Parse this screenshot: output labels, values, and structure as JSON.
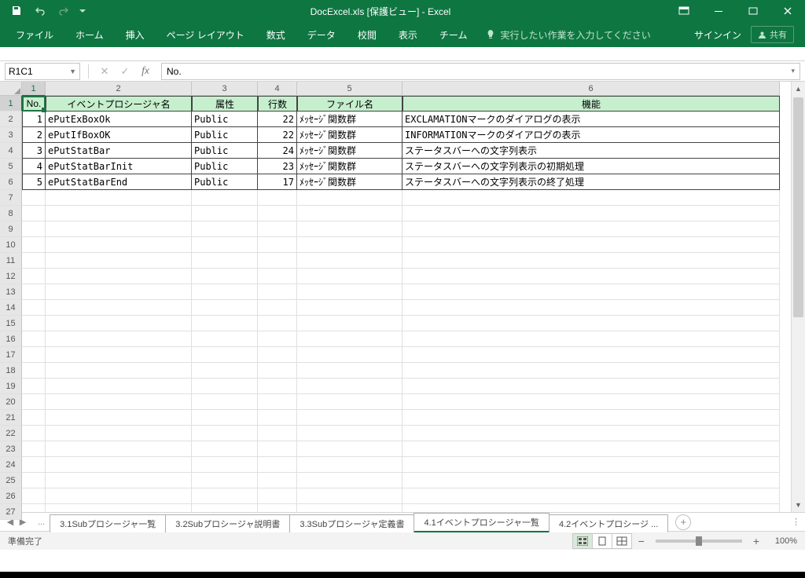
{
  "window": {
    "title": "DocExcel.xls  [保護ビュー] - Excel"
  },
  "ribbon": {
    "tabs": [
      "ファイル",
      "ホーム",
      "挿入",
      "ページ レイアウト",
      "数式",
      "データ",
      "校閲",
      "表示",
      "チーム"
    ],
    "tellme": "実行したい作業を入力してください",
    "signin": "サインイン",
    "share": "共有"
  },
  "namebox": "R1C1",
  "formula": "No.",
  "columns": {
    "widths": [
      30,
      186,
      84,
      50,
      134,
      480
    ],
    "labels": [
      "1",
      "2",
      "3",
      "4",
      "5",
      "6"
    ]
  },
  "row_count": 27,
  "headers": [
    "No.",
    "イベントプロシージャ名",
    "属性",
    "行数",
    "ファイル名",
    "機能"
  ],
  "rows": [
    {
      "no": "1",
      "name": "ePutExBoxOk",
      "attr": "Public",
      "lines": "22",
      "file": "ﾒｯｾｰｼﾞ関数群",
      "func": "EXCLAMATIONマークのダイアログの表示"
    },
    {
      "no": "2",
      "name": "ePutIfBoxOK",
      "attr": "Public",
      "lines": "22",
      "file": "ﾒｯｾｰｼﾞ関数群",
      "func": "INFORMATIONマークのダイアログの表示"
    },
    {
      "no": "3",
      "name": "ePutStatBar",
      "attr": "Public",
      "lines": "24",
      "file": "ﾒｯｾｰｼﾞ関数群",
      "func": "ステータスバーへの文字列表示"
    },
    {
      "no": "4",
      "name": "ePutStatBarInit",
      "attr": "Public",
      "lines": "23",
      "file": "ﾒｯｾｰｼﾞ関数群",
      "func": "ステータスバーへの文字列表示の初期処理"
    },
    {
      "no": "5",
      "name": "ePutStatBarEnd",
      "attr": "Public",
      "lines": "17",
      "file": "ﾒｯｾｰｼﾞ関数群",
      "func": "ステータスバーへの文字列表示の終了処理"
    }
  ],
  "sheets": {
    "list": [
      "3.1Subプロシージャ一覧",
      "3.2Subプロシージャ説明書",
      "3.3Subプロシージャ定義書",
      "4.1イベントプロシージャ一覧",
      "4.2イベントプロシージ ..."
    ],
    "active_index": 3
  },
  "status": {
    "ready": "準備完了",
    "zoom": "100%"
  }
}
